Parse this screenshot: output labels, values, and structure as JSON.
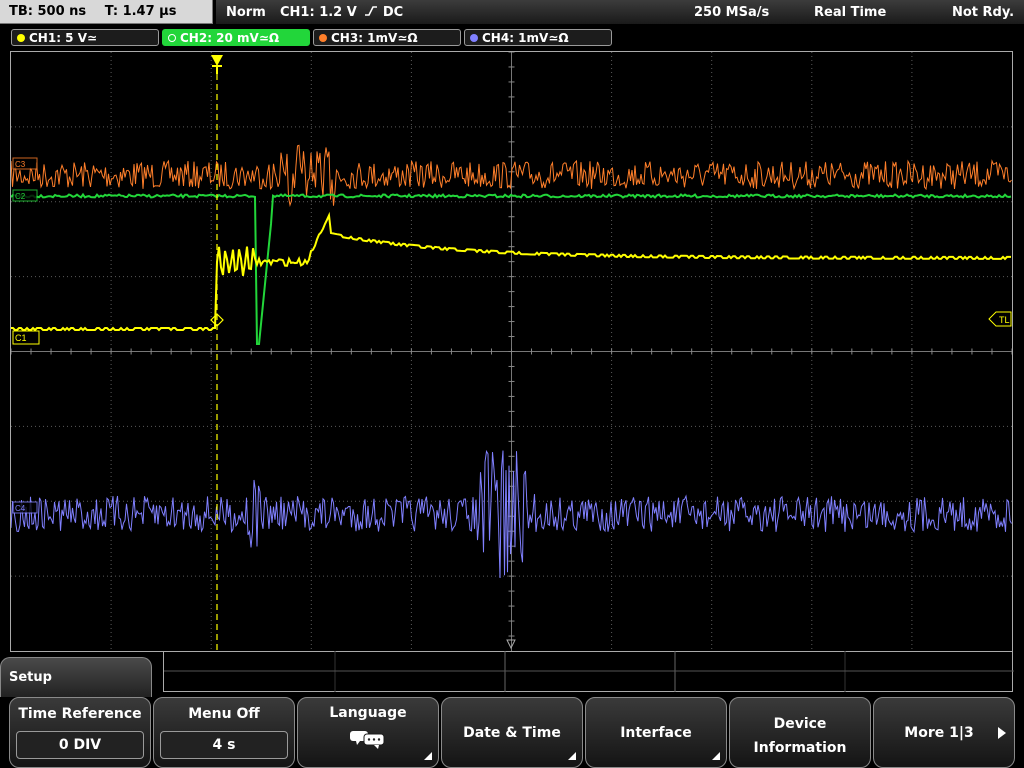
{
  "status": {
    "timebase": "TB: 500 ns",
    "trigger_time": "T: 1.47 µs",
    "mode": "Norm",
    "trigger_source": "CH1: 1.2 V",
    "trigger_slope": "⎍",
    "trigger_coupling": "DC",
    "sample_rate": "250 MSa/s",
    "acq_mode": "Real Time",
    "state": "Not Rdy."
  },
  "channels": [
    {
      "label": "CH1: 5 V≃",
      "color": "#ffff00",
      "active": false
    },
    {
      "label": "CH2: 20 mV≃Ω",
      "color": "#22d63a",
      "active": true
    },
    {
      "label": "CH3: 1mV≃Ω",
      "color": "#ff7f2a",
      "active": false
    },
    {
      "label": "CH4: 1mV≃Ω",
      "color": "#8080ff",
      "active": false
    }
  ],
  "markers": {
    "ch1_ground": "C1",
    "trigger_level": "TL",
    "ch2_ground": "C2",
    "ch3_ground": "C3",
    "ch4_ground": "C4"
  },
  "menu": {
    "title": "Setup",
    "softkeys": [
      {
        "label": "Time Reference",
        "value": "0 DIV"
      },
      {
        "label": "Menu Off",
        "value": "4 s"
      },
      {
        "label": "Language",
        "icon": "speech-bubbles-icon"
      },
      {
        "label": "Date & Time"
      },
      {
        "label": "Interface"
      },
      {
        "label": "Device",
        "label2": "Information"
      },
      {
        "label": "More 1|3"
      }
    ]
  },
  "colors": {
    "ch1": "#ffff00",
    "ch2": "#22d63a",
    "ch3": "#ff7f2a",
    "ch4": "#8080ff",
    "grid": "#5a5a5a"
  }
}
